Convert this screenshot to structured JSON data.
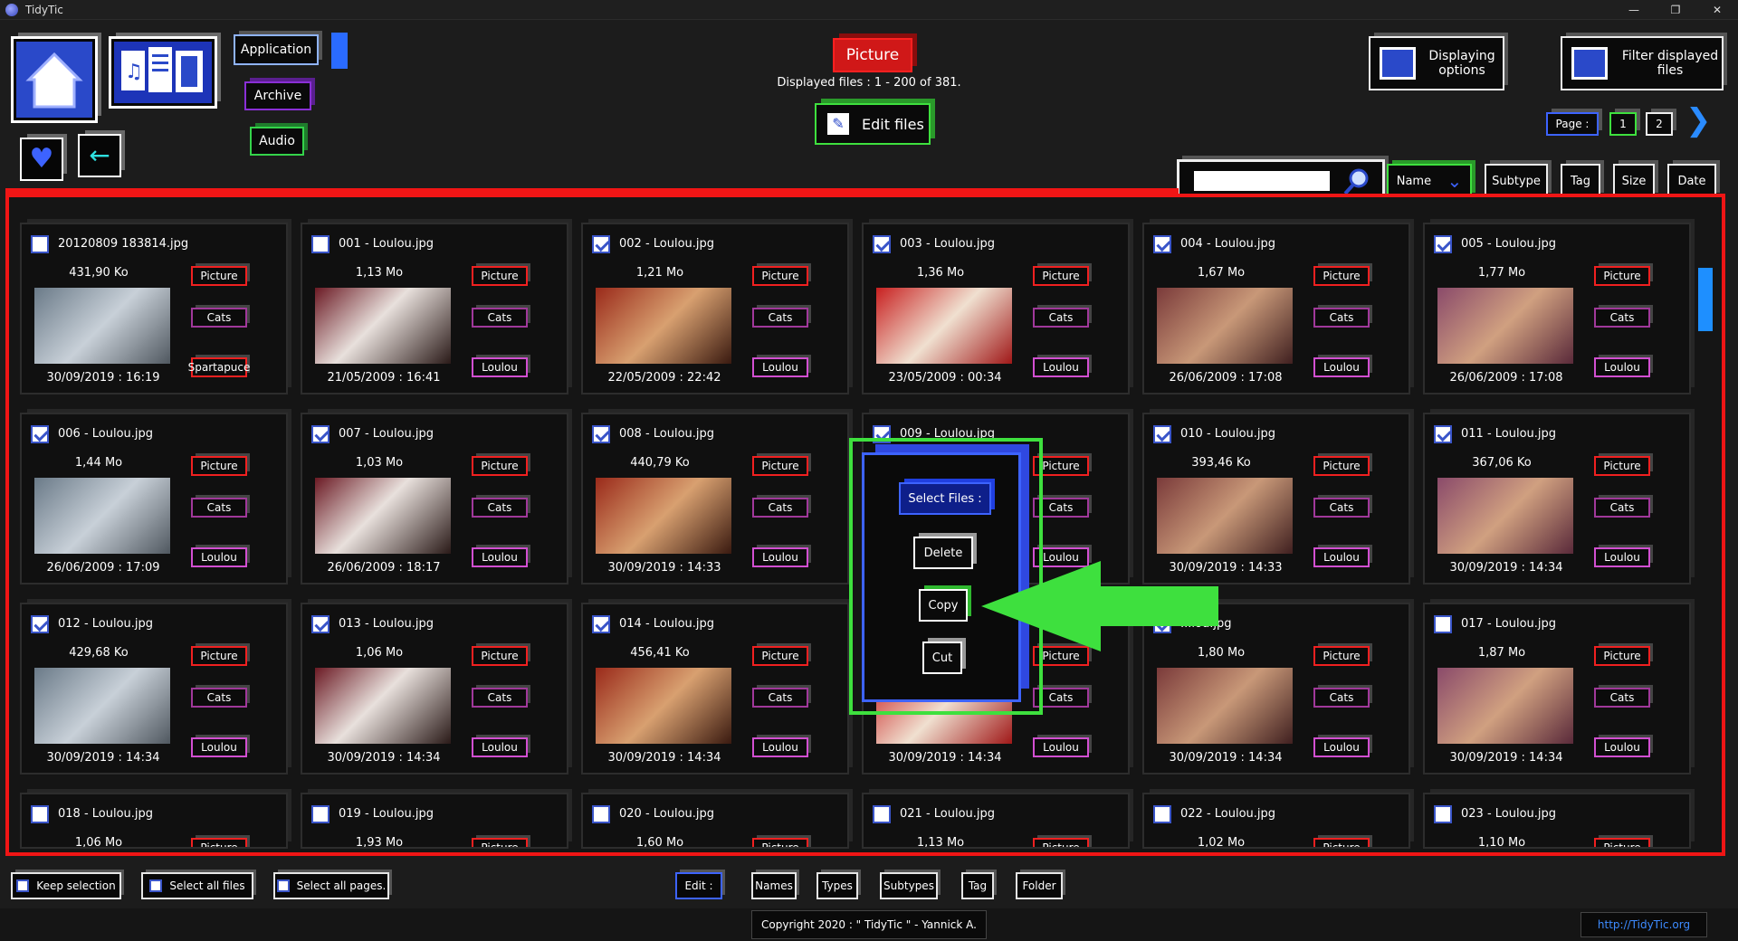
{
  "window": {
    "title": "TidyTic",
    "controls": [
      "—",
      "❐",
      "✕"
    ]
  },
  "header": {
    "categories": {
      "application": "Application",
      "archive": "Archive",
      "audio": "Audio"
    },
    "current_type": "Picture",
    "displayed_text": "Displayed files : 1 - 200 of 381.",
    "edit_files": "Edit files",
    "displaying_options": "Displaying options",
    "filter_files": "Filter displayed files",
    "page_label": "Page :",
    "pages": [
      "1",
      "2"
    ]
  },
  "sortbar": {
    "search_value": "",
    "name": "Name",
    "subtype": "Subtype",
    "tag": "Tag",
    "size": "Size",
    "date": "Date"
  },
  "files": [
    {
      "name": "20120809 183814.jpg",
      "size": "431,90 Ko",
      "date": "30/09/2019 : 16:19",
      "type": "Picture",
      "subtype": "Cats",
      "tag": "Spartapuce",
      "checked": false
    },
    {
      "name": "001 - Loulou.jpg",
      "size": "1,13 Mo",
      "date": "21/05/2009 : 16:41",
      "type": "Picture",
      "subtype": "Cats",
      "tag": "Loulou",
      "checked": false
    },
    {
      "name": "002 - Loulou.jpg",
      "size": "1,21 Mo",
      "date": "22/05/2009 : 22:42",
      "type": "Picture",
      "subtype": "Cats",
      "tag": "Loulou",
      "checked": true
    },
    {
      "name": "003 - Loulou.jpg",
      "size": "1,36 Mo",
      "date": "23/05/2009 : 00:34",
      "type": "Picture",
      "subtype": "Cats",
      "tag": "Loulou",
      "checked": true
    },
    {
      "name": "004 - Loulou.jpg",
      "size": "1,67 Mo",
      "date": "26/06/2009 : 17:08",
      "type": "Picture",
      "subtype": "Cats",
      "tag": "Loulou",
      "checked": true
    },
    {
      "name": "005 - Loulou.jpg",
      "size": "1,77 Mo",
      "date": "26/06/2009 : 17:08",
      "type": "Picture",
      "subtype": "Cats",
      "tag": "Loulou",
      "checked": true
    },
    {
      "name": "006 - Loulou.jpg",
      "size": "1,44 Mo",
      "date": "26/06/2009 : 17:09",
      "type": "Picture",
      "subtype": "Cats",
      "tag": "Loulou",
      "checked": true
    },
    {
      "name": "007 - Loulou.jpg",
      "size": "1,03 Mo",
      "date": "26/06/2009 : 18:17",
      "type": "Picture",
      "subtype": "Cats",
      "tag": "Loulou",
      "checked": true
    },
    {
      "name": "008 - Loulou.jpg",
      "size": "440,79 Ko",
      "date": "30/09/2019 : 14:33",
      "type": "Picture",
      "subtype": "Cats",
      "tag": "Loulou",
      "checked": true
    },
    {
      "name": "009 - Loulou.jpg",
      "size": "",
      "date": "",
      "type": "Picture",
      "subtype": "Cats",
      "tag": "Loulou",
      "checked": true
    },
    {
      "name": "010 - Loulou.jpg",
      "size": "393,46 Ko",
      "date": "30/09/2019 : 14:33",
      "type": "Picture",
      "subtype": "Cats",
      "tag": "Loulou",
      "checked": true
    },
    {
      "name": "011 - Loulou.jpg",
      "size": "367,06 Ko",
      "date": "30/09/2019 : 14:34",
      "type": "Picture",
      "subtype": "Cats",
      "tag": "Loulou",
      "checked": true
    },
    {
      "name": "012 - Loulou.jpg",
      "size": "429,68 Ko",
      "date": "30/09/2019 : 14:34",
      "type": "Picture",
      "subtype": "Cats",
      "tag": "Loulou",
      "checked": true
    },
    {
      "name": "013 - Loulou.jpg",
      "size": "1,06 Mo",
      "date": "30/09/2019 : 14:34",
      "type": "Picture",
      "subtype": "Cats",
      "tag": "Loulou",
      "checked": true
    },
    {
      "name": "014 - Loulou.jpg",
      "size": "456,41 Ko",
      "date": "30/09/2019 : 14:34",
      "type": "Picture",
      "subtype": "Cats",
      "tag": "Loulou",
      "checked": true
    },
    {
      "name": "",
      "size": "",
      "date": "30/09/2019 : 14:34",
      "type": "Picture",
      "subtype": "Cats",
      "tag": "Loulou",
      "checked": true
    },
    {
      "name": "...lou.jpg",
      "size": "1,80 Mo",
      "date": "30/09/2019 : 14:34",
      "type": "Picture",
      "subtype": "Cats",
      "tag": "Loulou",
      "checked": true
    },
    {
      "name": "017 - Loulou.jpg",
      "size": "1,87 Mo",
      "date": "30/09/2019 : 14:34",
      "type": "Picture",
      "subtype": "Cats",
      "tag": "Loulou",
      "checked": false
    },
    {
      "name": "018 - Loulou.jpg",
      "size": "1,06 Mo",
      "date": "",
      "type": "Picture",
      "subtype": "",
      "tag": "",
      "checked": false
    },
    {
      "name": "019 - Loulou.jpg",
      "size": "1,93 Mo",
      "date": "",
      "type": "Picture",
      "subtype": "",
      "tag": "",
      "checked": false
    },
    {
      "name": "020 - Loulou.jpg",
      "size": "1,60 Mo",
      "date": "",
      "type": "Picture",
      "subtype": "",
      "tag": "",
      "checked": false
    },
    {
      "name": "021 - Loulou.jpg",
      "size": "1,13 Mo",
      "date": "",
      "type": "Picture",
      "subtype": "",
      "tag": "",
      "checked": false
    },
    {
      "name": "022 - Loulou.jpg",
      "size": "1,02 Mo",
      "date": "",
      "type": "Picture",
      "subtype": "",
      "tag": "",
      "checked": false
    },
    {
      "name": "023 - Loulou.jpg",
      "size": "1,10 Mo",
      "date": "",
      "type": "Picture",
      "subtype": "",
      "tag": "",
      "checked": false
    }
  ],
  "popup": {
    "title": "Select Files :",
    "delete": "Delete",
    "copy": "Copy",
    "cut": "Cut"
  },
  "bottom": {
    "keep": "Keep selection",
    "select_all": "Select all files",
    "select_pages": "Select all pages.",
    "edit": "Edit :",
    "names": "Names",
    "types": "Types",
    "subtypes": "Subtypes",
    "tag": "Tag",
    "folder": "Folder"
  },
  "footer": {
    "copyright": "Copyright 2020 : \" TidyTic \" - Yannick A.",
    "link": "http://TidyTic.org"
  },
  "colors": {
    "accent_red": "#f01515",
    "accent_blue": "#2a6bff",
    "accent_green": "#3ee03e",
    "purple": "#8a2fd6"
  }
}
